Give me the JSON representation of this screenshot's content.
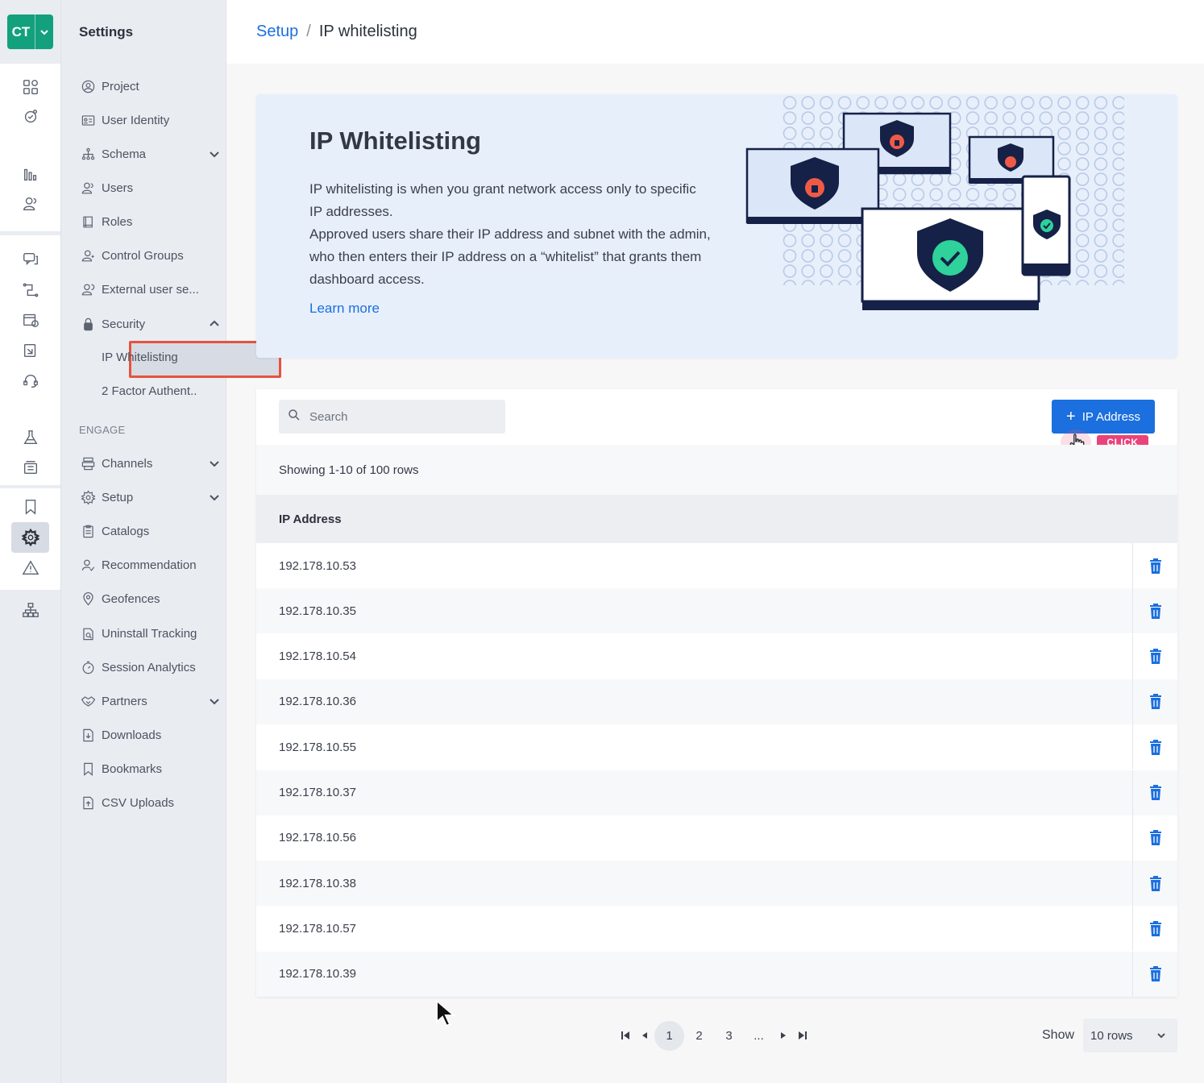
{
  "app": {
    "logo_text": "CT"
  },
  "sidebar": {
    "title": "Settings",
    "items": [
      {
        "label": "Project",
        "icon": "user-circle-icon"
      },
      {
        "label": "User Identity",
        "icon": "id-card-icon"
      },
      {
        "label": "Schema",
        "icon": "hierarchy-icon",
        "caret": "down"
      },
      {
        "label": "Users",
        "icon": "users-icon"
      },
      {
        "label": "Roles",
        "icon": "book-icon"
      },
      {
        "label": "Control Groups",
        "icon": "user-group-icon"
      },
      {
        "label": "External user se...",
        "icon": "user-external-icon"
      },
      {
        "label": "Security",
        "icon": "lock-icon",
        "caret": "up"
      }
    ],
    "security_subitems": [
      "IP Whitelisting",
      "2 Factor Authent.."
    ],
    "section_engage": "ENGAGE",
    "engage_items": [
      {
        "label": "Channels",
        "icon": "channels-icon",
        "caret": "down"
      },
      {
        "label": "Setup",
        "icon": "gear-icon",
        "caret": "down"
      },
      {
        "label": "Catalogs",
        "icon": "catalog-icon"
      },
      {
        "label": "Recommendation",
        "icon": "user-check-icon"
      },
      {
        "label": "Geofences",
        "icon": "location-pin-icon"
      },
      {
        "label": "Uninstall Tracking",
        "icon": "uninstall-icon"
      },
      {
        "label": "Session Analytics",
        "icon": "stopwatch-icon"
      },
      {
        "label": "Partners",
        "icon": "handshake-icon",
        "caret": "down"
      },
      {
        "label": "Downloads",
        "icon": "download-file-icon"
      },
      {
        "label": "Bookmarks",
        "icon": "bookmark-icon"
      },
      {
        "label": "CSV Uploads",
        "icon": "upload-file-icon"
      }
    ]
  },
  "header": {
    "breadcrumb_link": "Setup",
    "breadcrumb_sep": "/",
    "breadcrumb_current": "IP whitelisting"
  },
  "banner": {
    "title": "IP Whitelisting",
    "description_1": "IP whitelisting is when you grant network access only to specific IP addresses.",
    "description_2": "Approved users share their IP address and subnet with the admin, who then enters their IP address on a “whitelist” that grants them dashboard access.",
    "learn_more": "Learn more"
  },
  "table": {
    "search_placeholder": "Search",
    "add_button": "IP Address",
    "click_badge": "CLICK",
    "showing_text": "Showing 1-10 of 100 rows",
    "column_header": "IP Address",
    "rows": [
      "192.178.10.53",
      "192.178.10.35",
      "192.178.10.54",
      "192.178.10.36",
      "192.178.10.55",
      "192.178.10.37",
      "192.178.10.56",
      "192.178.10.38",
      "192.178.10.57",
      "192.178.10.39"
    ]
  },
  "pagination": {
    "pages": [
      "1",
      "2",
      "3",
      "..."
    ],
    "current": "1",
    "show_label": "Show",
    "rows_per_page": "10 rows"
  },
  "colors": {
    "accent": "#1b6fde",
    "brand": "#13a07d",
    "highlight_border": "#e5533f",
    "click_badge": "#e9437a"
  }
}
